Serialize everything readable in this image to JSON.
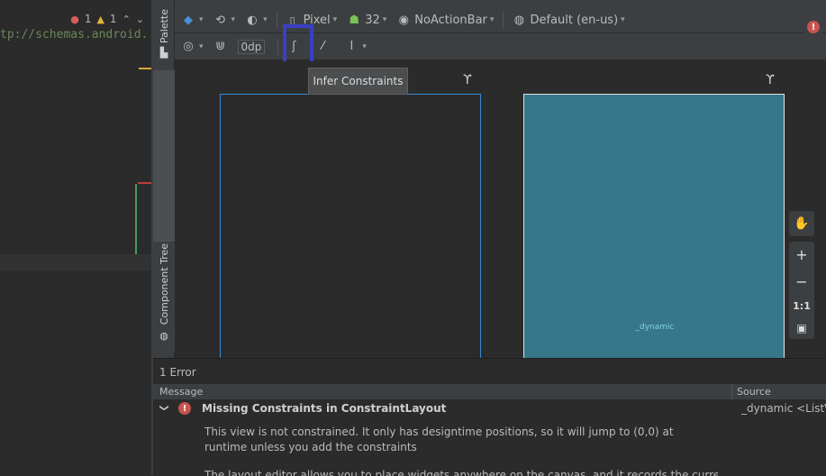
{
  "editor": {
    "error_count": "1",
    "warning_count": "1",
    "code_line": "tp://schemas.android."
  },
  "side_tabs": {
    "palette": "Palette",
    "component_tree": "Component Tree"
  },
  "toolbar": {
    "device": "Pixel",
    "api_level": "32",
    "theme": "NoActionBar",
    "locale": "Default (en-us)",
    "default_margin": "0dp"
  },
  "tooltip": {
    "text": "Infer Constraints"
  },
  "canvas": {
    "blueprint_view_label": "_dynamic",
    "zoom_fit_label": "1:1"
  },
  "issues": {
    "count_label": "1 Error",
    "columns": {
      "message": "Message",
      "source": "Source"
    },
    "items": [
      {
        "severity": "error",
        "title": "Missing Constraints in ConstraintLayout",
        "source": "_dynamic <ListVie",
        "description": "This view is not constrained. It only has designtime positions, so it will jump to (0,0) at runtime unless you add the constraints",
        "description_more": "The layout editor allows you to place widgets anywhere on the canvas, and it records the current position"
      }
    ]
  },
  "colors": {
    "accent_highlight": "#3a3fc4",
    "blueprint_bg": "#38768a",
    "error_red": "#c75450"
  }
}
